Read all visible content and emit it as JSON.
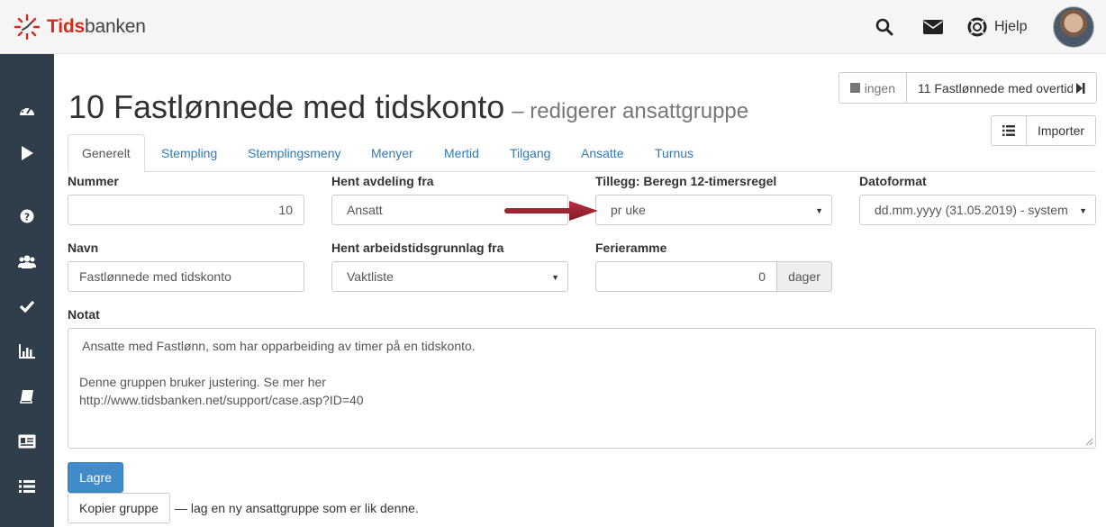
{
  "header": {
    "logo_brand": "Tids",
    "logo_rest": "banken",
    "search_icon": "search-icon",
    "mail_icon": "envelope-icon",
    "help_icon": "lifebuoy-icon",
    "help_label": "Hjelp"
  },
  "sidebar": {
    "items": [
      {
        "icon": "dashboard-icon"
      },
      {
        "icon": "play-icon"
      },
      {
        "icon": "question-icon"
      },
      {
        "icon": "users-icon"
      },
      {
        "icon": "check-icon"
      },
      {
        "icon": "bar-chart-icon"
      },
      {
        "icon": "book-icon"
      },
      {
        "icon": "id-card-icon"
      },
      {
        "icon": "list-icon"
      }
    ]
  },
  "title": {
    "main": "10 Fastlønnede med tidskonto",
    "sub": "– redigerer ansattgruppe"
  },
  "nav": {
    "prev_label": "ingen",
    "next_label": "11 Fastlønnede med overtid"
  },
  "import_label": "Importer",
  "tabs": [
    "Generelt",
    "Stempling",
    "Stemplingsmeny",
    "Menyer",
    "Mertid",
    "Tilgang",
    "Ansatte",
    "Turnus"
  ],
  "form": {
    "nummer_label": "Nummer",
    "nummer_value": "10",
    "avdeling_label": "Hent avdeling fra",
    "avdeling_value": "Ansatt",
    "tillegg_label": "Tillegg: Beregn 12-timersregel",
    "tillegg_value": "pr uke",
    "dato_label": "Datoformat",
    "dato_value": "dd.mm.yyyy (31.05.2019) - system",
    "navn_label": "Navn",
    "navn_value": "Fastlønnede med tidskonto",
    "arbeid_label": "Hent arbeidstidsgrunnlag fra",
    "arbeid_value": "Vaktliste",
    "ferie_label": "Ferieramme",
    "ferie_value": "0",
    "ferie_unit": "dager",
    "notat_label": "Notat",
    "notat_lines": [
      " Ansatte med Fastlønn, som har opparbeiding av timer på en tidskonto.",
      "",
      "Denne gruppen bruker justering. Se mer her",
      "http://www.tidsbanken.net/support/case.asp?ID=40"
    ]
  },
  "actions": {
    "save_label": "Lagre",
    "copy_label": "Kopier gruppe",
    "copy_note": "— lag en ny ansattgruppe som er lik denne."
  },
  "colors": {
    "brand_red": "#d52b1e",
    "sidebar_bg": "#2f3e4a",
    "link_blue": "#337ab7",
    "primary": "#428bca",
    "arrow": "#9b1b2a"
  }
}
